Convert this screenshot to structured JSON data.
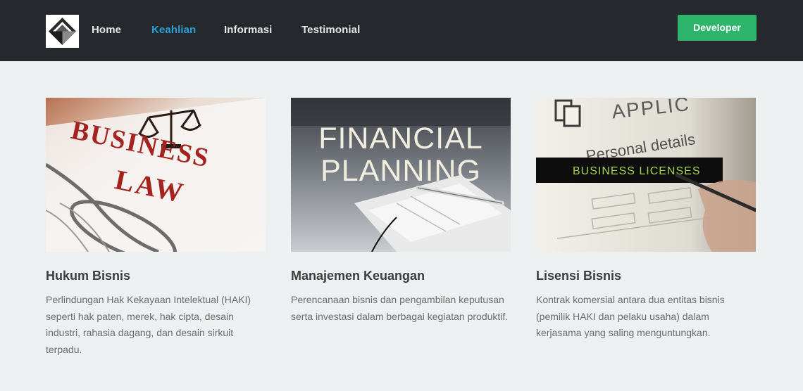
{
  "nav": {
    "logo_alt": "logo",
    "links": [
      {
        "label": "Home",
        "active": false
      },
      {
        "label": "Keahlian",
        "active": true
      },
      {
        "label": "Informasi",
        "active": false
      },
      {
        "label": "Testimonial",
        "active": false
      }
    ],
    "cta_label": "Developer"
  },
  "colors": {
    "navbar_bg": "#25282c",
    "active_link": "#2a9fd8",
    "cta_bg": "#2fb56b",
    "page_bg": "#edf0f1"
  },
  "cards": [
    {
      "image_text": [
        "BUSINESS",
        "LAW"
      ],
      "title": "Hukum Bisnis",
      "description": "Perlindungan Hak Kekayaan Intelektual (HAKI) seperti hak paten, merek, hak cipta, desain industri, rahasia dagang, dan desain sirkuit terpadu."
    },
    {
      "image_text": [
        "FINANCIAL",
        "PLANNING"
      ],
      "title": "Manajemen Keuangan",
      "description": "Perencanaan bisnis dan pengambilan keputusan serta investasi dalam berbagai kegiatan produktif."
    },
    {
      "image_text": [
        "APPLIC",
        "Personal details",
        "BUSINESS LICENSES"
      ],
      "title": "Lisensi Bisnis",
      "description": "Kontrak komersial antara dua entitas bisnis (pemilik HAKI dan pelaku usaha) dalam kerjasama yang saling menguntungkan."
    }
  ]
}
